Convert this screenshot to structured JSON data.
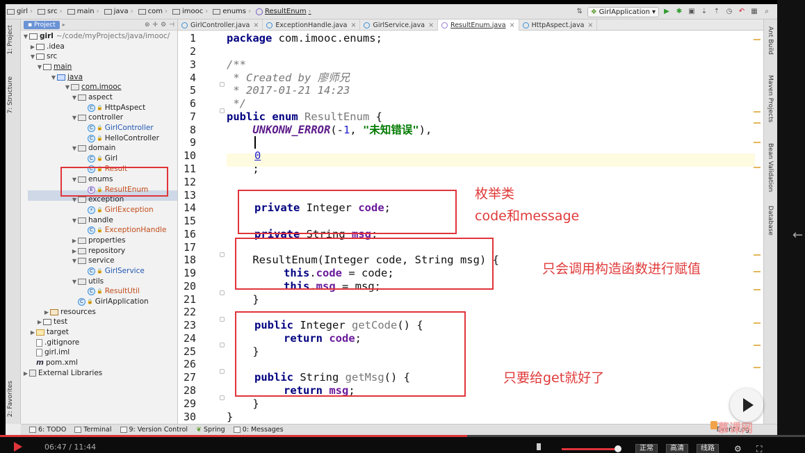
{
  "breadcrumb": [
    "girl",
    "src",
    "main",
    "java",
    "com",
    "imooc",
    "enums",
    "ResultEnum"
  ],
  "run_config": "GirlApplication",
  "left_strip": [
    "1: Project",
    "7: Structure",
    "2: Favorites"
  ],
  "right_strip": [
    "Ant Build",
    "Maven Projects",
    "Bean Validation",
    "Database"
  ],
  "project": {
    "tab_label": "Project",
    "root_label": "girl",
    "root_path": "~/code/myProjects/java/imooc/",
    "items": [
      ".idea",
      "src",
      "main",
      "java",
      "com.imooc",
      "aspect",
      "HttpAspect",
      "controller",
      "GirlController",
      "HelloController",
      "domain",
      "Girl",
      "Result",
      "enums",
      "ResultEnum",
      "exception",
      "GirlException",
      "handle",
      "ExceptionHandle",
      "properties",
      "repository",
      "service",
      "GirlService",
      "utils",
      "ResultUtil",
      "GirlApplication",
      "resources",
      "test",
      "target",
      ".gitignore",
      "girl.iml",
      "pom.xml",
      "External Libraries"
    ]
  },
  "tabs": [
    "GirlController.java",
    "ExceptionHandle.java",
    "GirlService.java",
    "ResultEnum.java",
    "HttpAspect.java"
  ],
  "line_numbers": [
    "1",
    "2",
    "3",
    "4",
    "5",
    "6",
    "7",
    "8",
    "9",
    "10",
    "11",
    "12",
    "13",
    "14",
    "15",
    "16",
    "17",
    "18",
    "19",
    "20",
    "21",
    "22",
    "23",
    "24",
    "25",
    "26",
    "27",
    "28",
    "29",
    "30"
  ],
  "code": {
    "l1_kw": "package",
    "l1_rest": " com.imooc.enums;",
    "l3": "/**",
    "l4": " * Created by 廖师兄",
    "l5": " * 2017-01-21 14:23",
    "l6": " */",
    "l7_kw": "public enum",
    "l7_name": " ResultEnum",
    "l7_rest": " {",
    "l8_indent": "    ",
    "l8_enum": "UNKONW_ERROR",
    "l8_open": "(-",
    "l8_num": "1",
    "l8_sep": ", ",
    "l8_str": "\"未知错误\"",
    "l8_close": "),",
    "l10_num": "0",
    "l11": "    ;",
    "l13_kw": "private",
    "l13_type": " Integer ",
    "l13_fld": "code",
    "l13_end": ";",
    "l15_kw": "private",
    "l15_type": " String ",
    "l15_fld": "msg",
    "l15_end": ";",
    "l17": "    ResultEnum(Integer code, String msg) {",
    "l18_kw": "this",
    "l18_dot": ".",
    "l18_fld": "code",
    "l18_rest": " = code;",
    "l19_kw": "this",
    "l19_dot": ".",
    "l19_fld": "msg",
    "l19_rest": " = msg;",
    "l20": "    }",
    "l22_kw": "public",
    "l22_type": " Integer ",
    "l22_name": "getCode",
    "l22_rest": "() {",
    "l23_kw": "return",
    "l23_fld": " code",
    "l23_end": ";",
    "l24": "    }",
    "l26_kw": "public",
    "l26_type": " String ",
    "l26_name": "getMsg",
    "l26_rest": "() {",
    "l27_kw": "return",
    "l27_fld": " msg",
    "l27_end": ";",
    "l28": "    }",
    "l29": "}"
  },
  "annotations": {
    "a1_line1": "枚举类",
    "a1_line2": "code和message",
    "a2": "只会调用构造函数进行赋值",
    "a3": "只要给get就好了"
  },
  "bottom_bar": {
    "todo": "6: TODO",
    "terminal": "Terminal",
    "vcs": "9: Version Control",
    "spring": "Spring",
    "messages": "0: Messages",
    "event_log": "Event Log"
  },
  "watermark": "慕课网",
  "video": {
    "time": "06:47 / 11:44",
    "progress": 0.58,
    "volume": 0.95,
    "quality_normal": "正常",
    "quality_hd": "高清",
    "route": "线路"
  },
  "colors": {
    "annotation": "#e0343a",
    "keyword": "#000080",
    "string": "#007a00",
    "field": "#6a1b9a"
  }
}
